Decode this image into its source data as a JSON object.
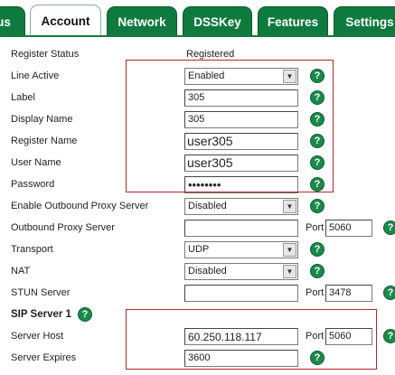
{
  "tabs": [
    {
      "label": "us",
      "active": false
    },
    {
      "label": "Account",
      "active": true
    },
    {
      "label": "Network",
      "active": false
    },
    {
      "label": "DSSKey",
      "active": false
    },
    {
      "label": "Features",
      "active": false
    },
    {
      "label": "Settings",
      "active": false
    }
  ],
  "colors": {
    "tab_green": "#0f7a3d",
    "help_green": "#1a8a4a",
    "highlight_red": "#b3262b"
  },
  "form": {
    "register_status": {
      "label": "Register Status",
      "value": "Registered"
    },
    "line_active": {
      "label": "Line Active",
      "value": "Enabled"
    },
    "label": {
      "label": "Label",
      "value": "305"
    },
    "display_name": {
      "label": "Display Name",
      "value": "305"
    },
    "register_name": {
      "label": "Register Name",
      "value": "user305"
    },
    "user_name": {
      "label": "User Name",
      "value": "user305"
    },
    "password": {
      "label": "Password",
      "value": "••••••••"
    },
    "enable_outbound_proxy": {
      "label": "Enable Outbound Proxy Server",
      "value": "Disabled"
    },
    "outbound_proxy_server": {
      "label": "Outbound Proxy Server",
      "value": "",
      "port_label": "Port",
      "port": "5060"
    },
    "transport": {
      "label": "Transport",
      "value": "UDP"
    },
    "nat": {
      "label": "NAT",
      "value": "Disabled"
    },
    "stun_server": {
      "label": "STUN Server",
      "value": "",
      "port_label": "Port",
      "port": "3478"
    },
    "sip_server_1": {
      "label": "SIP Server 1"
    },
    "server_host": {
      "label": "Server Host",
      "value": "60.250.118.117",
      "port_label": "Port",
      "port": "5060"
    },
    "server_expires": {
      "label": "Server Expires",
      "value": "3600"
    }
  },
  "icons": {
    "help": "help-icon",
    "dropdown": "dropdown-arrow-icon"
  }
}
